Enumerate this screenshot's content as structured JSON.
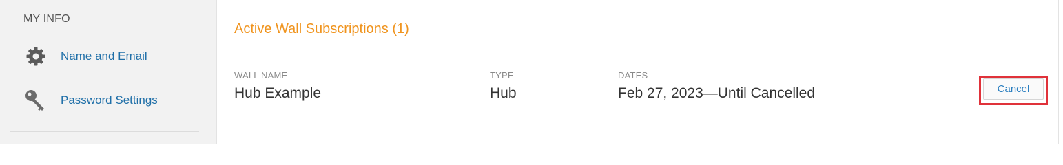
{
  "sidebar": {
    "heading": "MY INFO",
    "items": [
      {
        "label": "Name and Email",
        "icon": "gear-icon"
      },
      {
        "label": "Password Settings",
        "icon": "key-icon"
      }
    ]
  },
  "main": {
    "section_title": "Active Wall Subscriptions (1)",
    "columns": {
      "wall_name_header": "WALL NAME",
      "type_header": "TYPE",
      "dates_header": "DATES"
    },
    "rows": [
      {
        "wall_name": "Hub Example",
        "type": "Hub",
        "dates": "Feb 27, 2023—Until Cancelled",
        "cancel_label": "Cancel"
      }
    ]
  },
  "colors": {
    "accent_orange": "#f0941e",
    "link_blue": "#1f6fa8",
    "highlight_red": "#e0323a"
  }
}
